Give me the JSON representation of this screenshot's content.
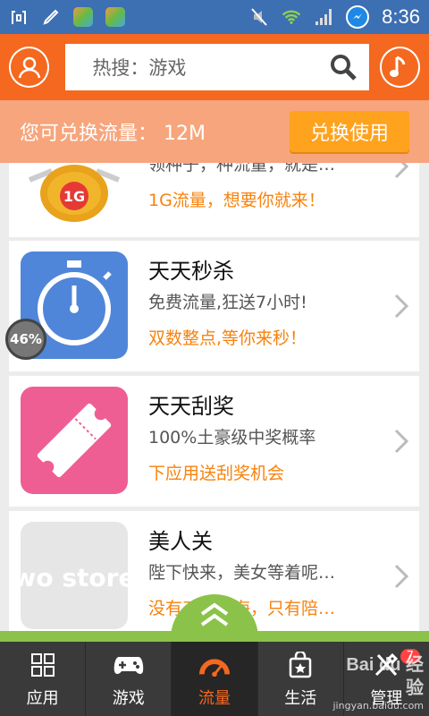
{
  "status_bar": {
    "time": "8:36"
  },
  "header": {
    "search_placeholder": "热搜：游戏"
  },
  "exchange": {
    "text": "您可兑换流量：  12M",
    "button_label": "兑换使用"
  },
  "cards": [
    {
      "title": "",
      "desc": "领种子，种流量，就是…",
      "promo": "1G流量，想要你就来！",
      "icon_text": "1G"
    },
    {
      "title": "天天秒杀",
      "desc": "免费流量,狂送7小时!",
      "promo": "双数整点,等你来秒！"
    },
    {
      "title": "天天刮奖",
      "desc": "100%土豪级中奖概率",
      "promo": "下应用送刮奖机会"
    },
    {
      "title": "美人关",
      "desc": "陛下快来，美女等着呢…",
      "promo": "没有刀山火海，只有陪…",
      "icon_text": "wo store"
    }
  ],
  "progress_badge": "46%",
  "tabs": [
    {
      "label": "应用",
      "icon": "grid-icon"
    },
    {
      "label": "游戏",
      "icon": "gamepad-icon"
    },
    {
      "label": "流量",
      "icon": "gauge-icon",
      "active": true
    },
    {
      "label": "生活",
      "icon": "bag-icon"
    },
    {
      "label": "管理",
      "icon": "tools-icon",
      "badge": "7"
    }
  ],
  "watermark": {
    "brand": "Bai du 经验",
    "url": "jingyan.baidu.com"
  },
  "colors": {
    "accent": "#f4681f",
    "promo": "#f7820d",
    "green": "#8bc34a"
  }
}
